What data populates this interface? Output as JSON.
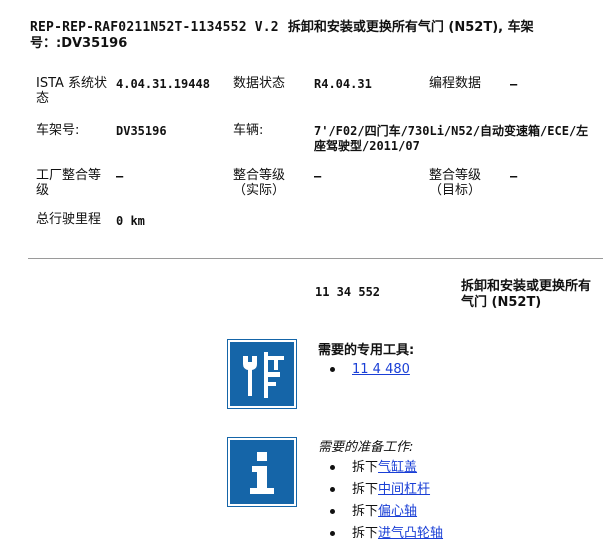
{
  "header": {
    "code": "REP-REP-RAF0211N52T-1134552 V.2",
    "title_cn": "拆卸和安装或更换所有气门 (N52T), 车架号：:DV35196"
  },
  "info": {
    "ista_label": "ISTA 系统状态",
    "ista_value": "4.04.31.19448",
    "data_status_label": "数据状态",
    "data_status_value": "R4.04.31",
    "programming_label": "编程数据",
    "programming_value": "–",
    "vin_label": "车架号:",
    "vin_value": "DV35196",
    "vehicle_label": "车辆:",
    "vehicle_value": "7'/F02/四门车/730Li/N52/自动变速箱/ECE/左座驾驶型/2011/07",
    "factory_label": "工厂整合等级",
    "factory_value": "–",
    "actual_label": "整合等级（实际）",
    "actual_value": "–",
    "target_label": "整合等级（目标）",
    "target_value": "–",
    "mileage_label": "总行驶里程",
    "mileage_value": "0 km"
  },
  "repair": {
    "number": "11 34 552",
    "title": "拆卸和安装或更换所有气门 (N52T)"
  },
  "tools": {
    "icon": "tools-icon",
    "heading": "需要的专用工具:",
    "items": [
      "11 4 480"
    ]
  },
  "prep": {
    "icon": "info-icon",
    "heading": "需要的准备工作:",
    "items": [
      {
        "prefix": "拆下",
        "link": "气缸盖"
      },
      {
        "prefix": "拆下",
        "link": "中间杠杆"
      },
      {
        "prefix": "拆下",
        "link": "偏心轴"
      },
      {
        "prefix": "拆下",
        "link": "进气凸轮轴"
      }
    ]
  },
  "colors": {
    "icon_blue": "#1565a8",
    "link_blue": "#1a3fd6",
    "divider": "#9a9a9a"
  }
}
